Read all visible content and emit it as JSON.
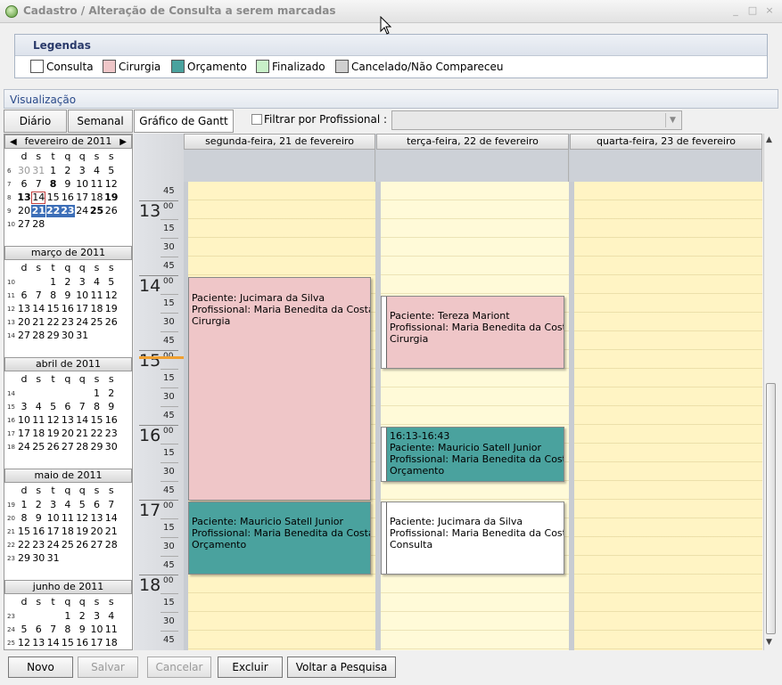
{
  "window": {
    "title": "Cadastro / Alteração de Consulta a serem marcadas",
    "controls": [
      "_",
      "□",
      "×"
    ]
  },
  "legend": {
    "title": "Legendas",
    "items": [
      {
        "label": "Consulta",
        "color": "#ffffff"
      },
      {
        "label": "Cirurgia",
        "color": "#efc6c8"
      },
      {
        "label": "Orçamento",
        "color": "#4aa29e"
      },
      {
        "label": "Finalizado",
        "color": "#c8f0c8"
      },
      {
        "label": "Cancelado/Não Compareceu",
        "color": "#d0d0d0"
      }
    ]
  },
  "visualizacao": {
    "title": "Visualização",
    "tabs": [
      "Diário",
      "Semanal",
      "Gráfico de Gantt"
    ],
    "filter_label": "Filtrar por Profissional :"
  },
  "calendar": {
    "day_headers": [
      "d",
      "s",
      "t",
      "q",
      "q",
      "s",
      "s"
    ],
    "months": [
      {
        "name": "fevereiro de 2011",
        "nav": true,
        "weeks": [
          {
            "wk": "6",
            "days": [
              "30",
              "31",
              "1",
              "2",
              "3",
              "4",
              "5"
            ],
            "gray": [
              0,
              1
            ]
          },
          {
            "wk": "7",
            "days": [
              "6",
              "7",
              "8",
              "9",
              "10",
              "11",
              "12"
            ],
            "bold": [
              2
            ]
          },
          {
            "wk": "8",
            "days": [
              "13",
              "14",
              "15",
              "16",
              "17",
              "18",
              "19"
            ],
            "bold": [
              0,
              6
            ],
            "today": [
              1
            ]
          },
          {
            "wk": "9",
            "days": [
              "20",
              "21",
              "22",
              "23",
              "24",
              "25",
              "26"
            ],
            "sel": [
              1,
              2,
              3
            ],
            "bold": [
              5
            ]
          },
          {
            "wk": "10",
            "days": [
              "27",
              "28",
              "",
              "",
              "",
              "",
              ""
            ]
          }
        ]
      },
      {
        "name": "março de 2011",
        "weeks": [
          {
            "wk": "10",
            "days": [
              "",
              "",
              "1",
              "2",
              "3",
              "4",
              "5"
            ]
          },
          {
            "wk": "11",
            "days": [
              "6",
              "7",
              "8",
              "9",
              "10",
              "11",
              "12"
            ]
          },
          {
            "wk": "12",
            "days": [
              "13",
              "14",
              "15",
              "16",
              "17",
              "18",
              "19"
            ]
          },
          {
            "wk": "13",
            "days": [
              "20",
              "21",
              "22",
              "23",
              "24",
              "25",
              "26"
            ]
          },
          {
            "wk": "14",
            "days": [
              "27",
              "28",
              "29",
              "30",
              "31",
              "",
              ""
            ]
          }
        ]
      },
      {
        "name": "abril de 2011",
        "weeks": [
          {
            "wk": "14",
            "days": [
              "",
              "",
              "",
              "",
              "",
              "1",
              "2"
            ]
          },
          {
            "wk": "15",
            "days": [
              "3",
              "4",
              "5",
              "6",
              "7",
              "8",
              "9"
            ]
          },
          {
            "wk": "16",
            "days": [
              "10",
              "11",
              "12",
              "13",
              "14",
              "15",
              "16"
            ]
          },
          {
            "wk": "17",
            "days": [
              "17",
              "18",
              "19",
              "20",
              "21",
              "22",
              "23"
            ]
          },
          {
            "wk": "18",
            "days": [
              "24",
              "25",
              "26",
              "27",
              "28",
              "29",
              "30"
            ]
          }
        ]
      },
      {
        "name": "maio de 2011",
        "weeks": [
          {
            "wk": "19",
            "days": [
              "1",
              "2",
              "3",
              "4",
              "5",
              "6",
              "7"
            ]
          },
          {
            "wk": "20",
            "days": [
              "8",
              "9",
              "10",
              "11",
              "12",
              "13",
              "14"
            ]
          },
          {
            "wk": "21",
            "days": [
              "15",
              "16",
              "17",
              "18",
              "19",
              "20",
              "21"
            ]
          },
          {
            "wk": "22",
            "days": [
              "22",
              "23",
              "24",
              "25",
              "26",
              "27",
              "28"
            ]
          },
          {
            "wk": "23",
            "days": [
              "29",
              "30",
              "31",
              "",
              "",
              "",
              ""
            ]
          }
        ]
      },
      {
        "name": "junho de 2011",
        "weeks": [
          {
            "wk": "23",
            "days": [
              "",
              "",
              "",
              "1",
              "2",
              "3",
              "4"
            ]
          },
          {
            "wk": "24",
            "days": [
              "5",
              "6",
              "7",
              "8",
              "9",
              "10",
              "11"
            ]
          },
          {
            "wk": "25",
            "days": [
              "12",
              "13",
              "14",
              "15",
              "16",
              "17",
              "18"
            ]
          }
        ]
      }
    ]
  },
  "schedule": {
    "columns": [
      "segunda-feira, 21 de fevereiro",
      "terça-feira, 22 de fevereiro",
      "quarta-feira, 23 de fevereiro"
    ],
    "hours": [
      "13",
      "14",
      "15",
      "16",
      "17",
      "18"
    ],
    "minute_labels": [
      "00",
      "15",
      "30",
      "45"
    ],
    "appointments": [
      {
        "col": 0,
        "lines": [
          "Paciente: Jucimara da Silva",
          "Profissional: Maria Benedita da Costa",
          "Cirurgia"
        ],
        "color": "#efc6c8"
      },
      {
        "col": 1,
        "lines": [
          "Paciente: Tereza Mariont",
          "Profissional: Maria Benedita da Costa",
          "Cirurgia"
        ],
        "color": "#efc6c8"
      },
      {
        "col": 1,
        "lines": [
          "16:13-16:43",
          "Paciente: Mauricio Satell Junior",
          "Profissional: Maria Benedita da Costa",
          "Orçamento"
        ],
        "color": "#4aa29e"
      },
      {
        "col": 0,
        "lines": [
          "Paciente: Mauricio Satell Junior",
          "Profissional: Maria Benedita da Costa",
          "Orçamento"
        ],
        "color": "#4aa29e"
      },
      {
        "col": 1,
        "lines": [
          "Paciente: Jucimara da Silva",
          "Profissional: Maria Benedita da Costa",
          "Consulta"
        ],
        "color": "#ffffff"
      }
    ]
  },
  "buttons": {
    "novo": "Novo",
    "salvar": "Salvar",
    "cancelar": "Cancelar",
    "excluir": "Excluir",
    "voltar": "Voltar a Pesquisa"
  }
}
